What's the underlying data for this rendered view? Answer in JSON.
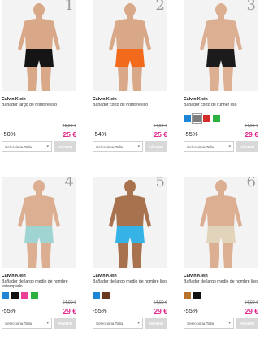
{
  "products": [
    {
      "rank": "1",
      "brand": "Calvin Klein",
      "name": "Bañador largo de hombre liso",
      "swatches": [],
      "discount": "-50%",
      "old_price": "49,90 €",
      "price": "25 €",
      "size_placeholder": "Selecciona Talla",
      "add_label": "AÑADIR",
      "shorts_color": "#151515",
      "skin": "#d9a888"
    },
    {
      "rank": "2",
      "brand": "Calvin Klein",
      "name": "Bañador corto de hombre liso",
      "swatches": [],
      "discount": "-54%",
      "old_price": "54,90 €",
      "price": "25 €",
      "size_placeholder": "Selecciona Talla",
      "add_label": "AÑADIR",
      "shorts_color": "#f26a1b",
      "skin": "#d9a888"
    },
    {
      "rank": "3",
      "brand": "Calvin Klein",
      "name": "Bañador corto de runner liso",
      "swatches": [
        "#1f86d6",
        "#7d7d7d",
        "#d42b2b",
        "#2bb23e"
      ],
      "discount": "-55%",
      "old_price": "64,90 €",
      "price": "29 €",
      "size_placeholder": "Selecciona Talla",
      "add_label": "AÑADIR",
      "shorts_color": "#1b1b1b",
      "skin": "#dcae92"
    },
    {
      "rank": "4",
      "brand": "Calvin Klein",
      "name": "Bañador de largo medio de hombre estampado",
      "swatches": [
        "#1f86d6",
        "#111111",
        "#ee3f97",
        "#2bb23e"
      ],
      "discount": "-55%",
      "old_price": "64,90 €",
      "price": "29 €",
      "size_placeholder": "Selecciona Talla",
      "add_label": "AÑADIR",
      "shorts_color": "#9fd4d2",
      "skin": "#dcae92"
    },
    {
      "rank": "5",
      "brand": "Calvin Klein",
      "name": "Bañador de largo medio de hombre liso",
      "swatches": [
        "#1f86d6",
        "#6b3a1e"
      ],
      "discount": "-55%",
      "old_price": "64,90 €",
      "price": "29 €",
      "size_placeholder": "Selecciona Talla",
      "add_label": "AÑADIR",
      "shorts_color": "#35b3e6",
      "skin": "#a8724e"
    },
    {
      "rank": "6",
      "brand": "Calvin Klein",
      "name": "Bañador de largo medio de hombre liso",
      "swatches": [
        "#b8742c",
        "#111111"
      ],
      "discount": "-55%",
      "old_price": "64,90 €",
      "price": "29 €",
      "size_placeholder": "Selecciona Talla",
      "add_label": "AÑADIR",
      "shorts_color": "#e2d4bb",
      "skin": "#dcae92"
    }
  ]
}
